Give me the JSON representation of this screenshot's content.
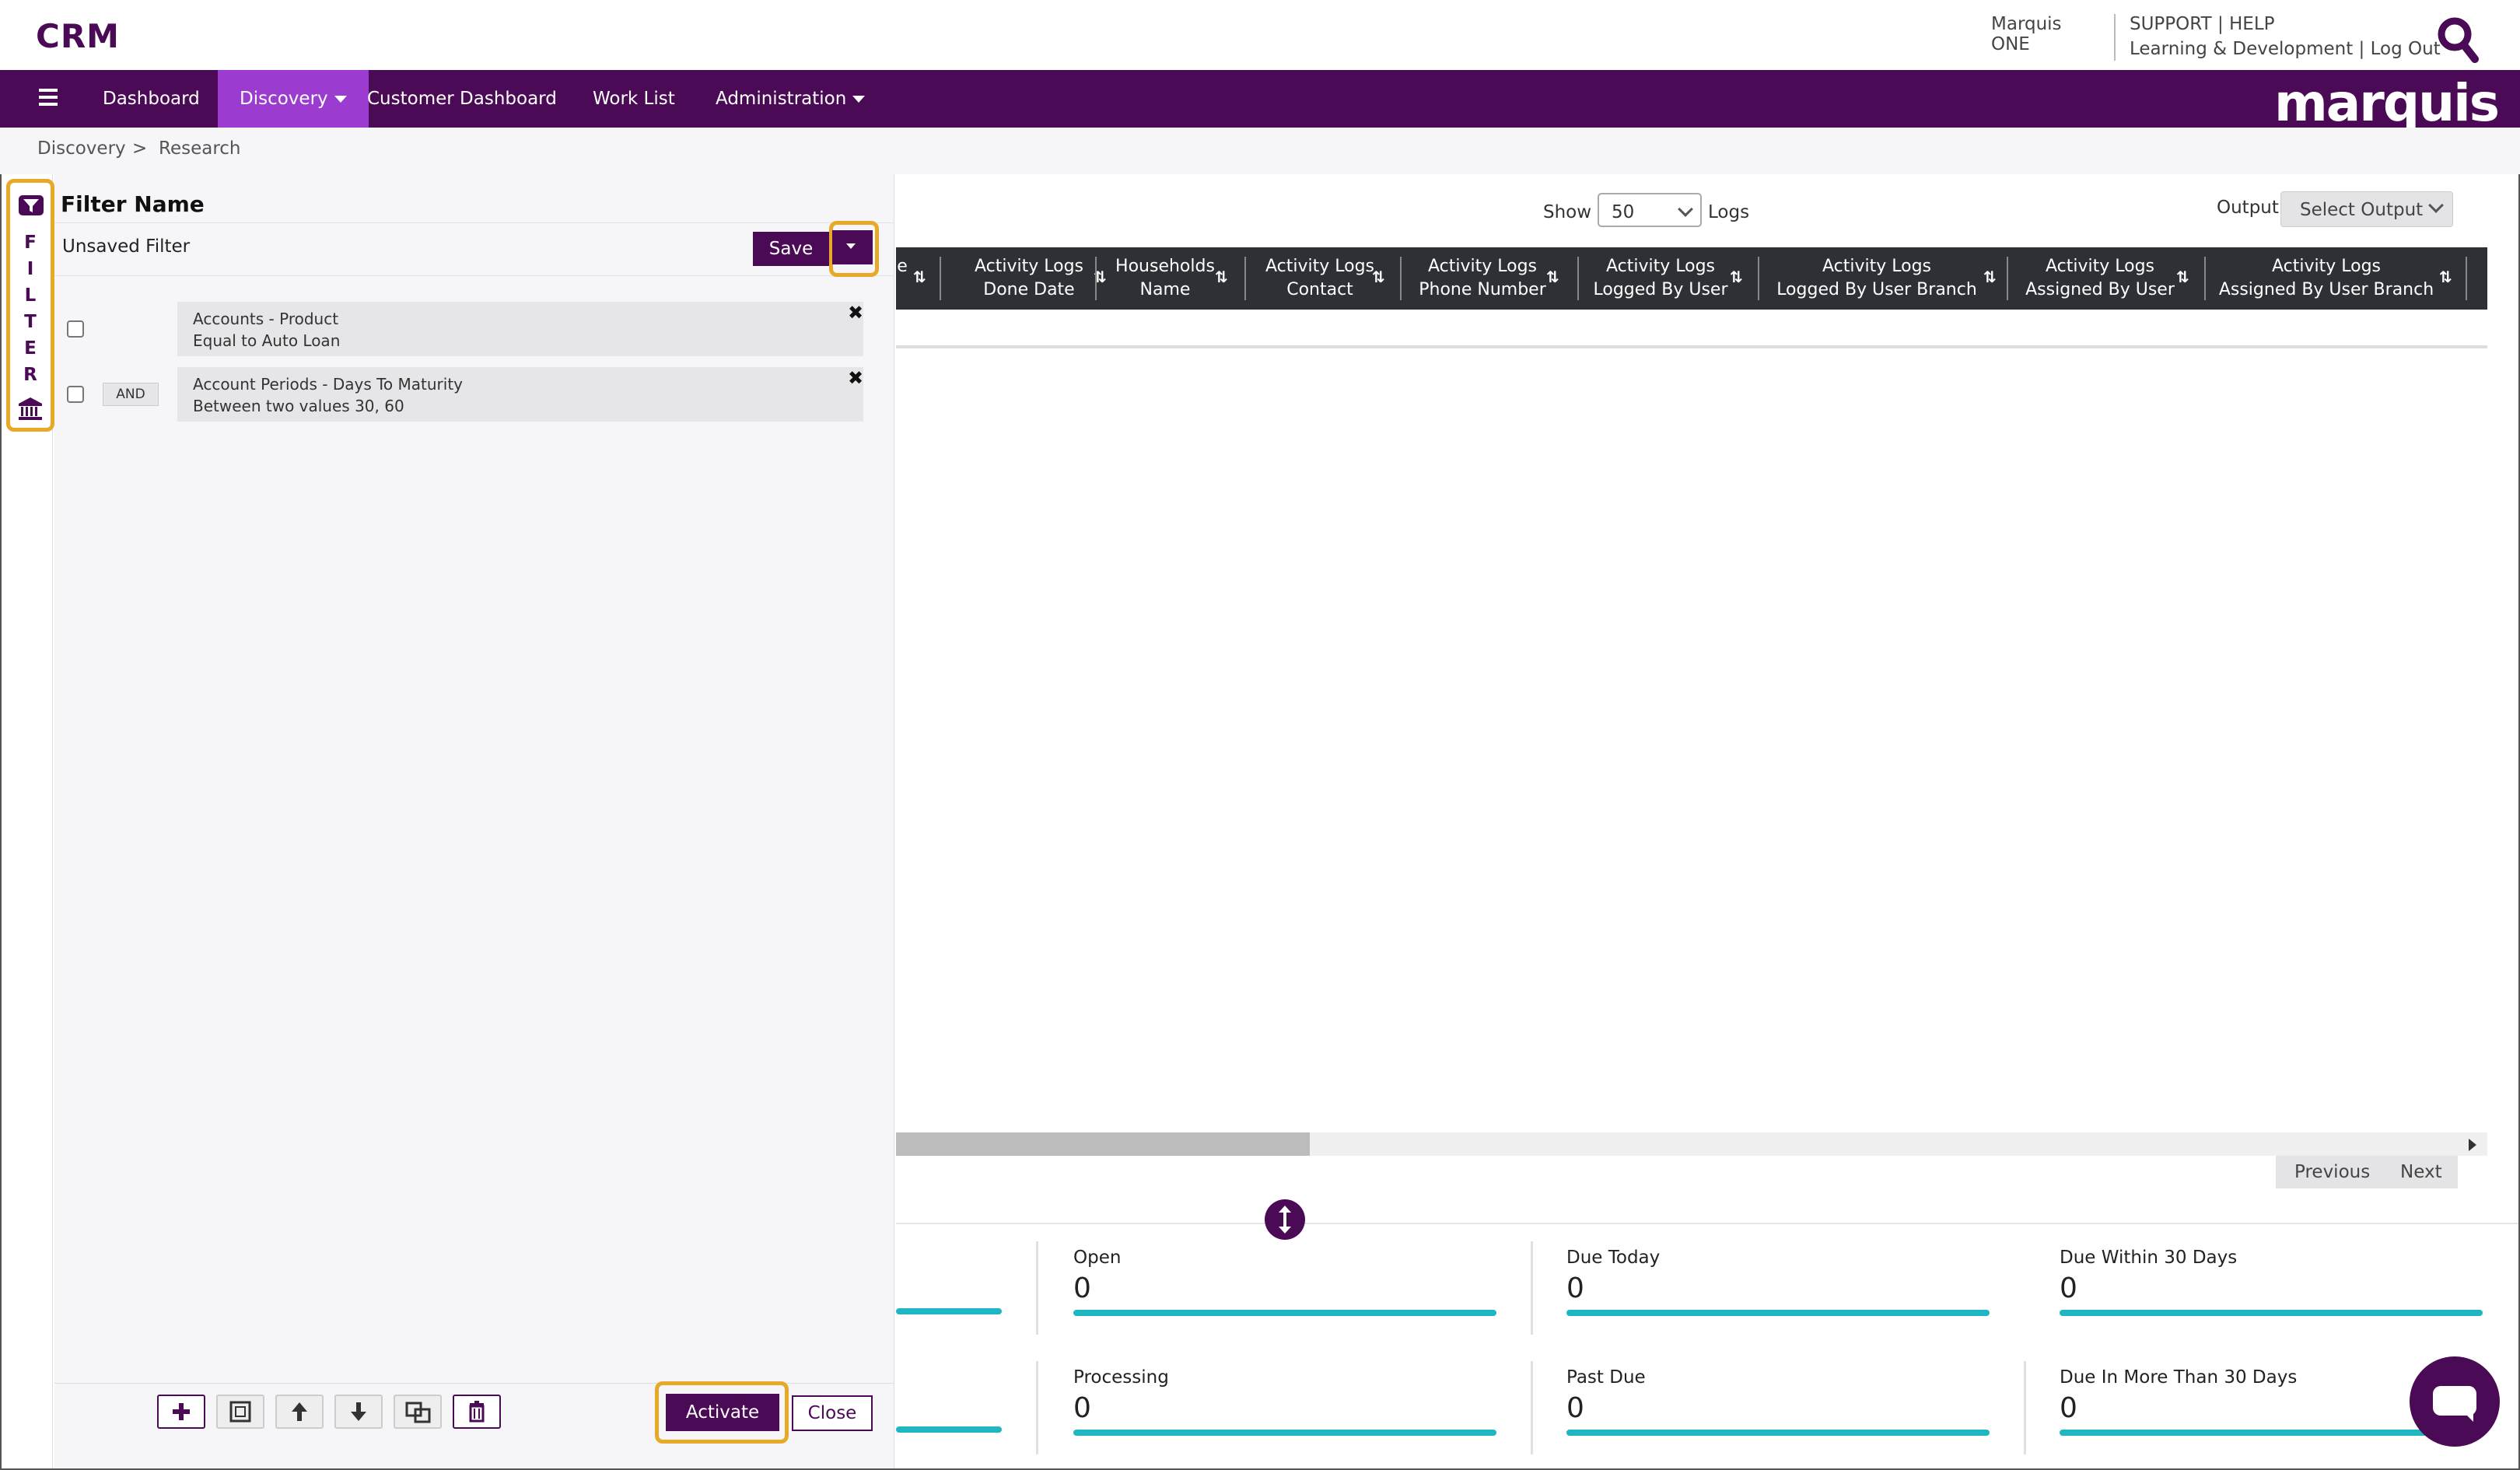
{
  "app": {
    "title": "CRM"
  },
  "top_links": {
    "marquis_one": "Marquis ONE",
    "support": "SUPPORT | HELP",
    "learning": "Learning & Development | Log Out"
  },
  "nav": {
    "brand": "marquis",
    "items": [
      {
        "label": "Dashboard"
      },
      {
        "label": "Discovery",
        "active": true,
        "dropdown": true
      },
      {
        "label": "Customer Dashboard"
      },
      {
        "label": "Work List"
      },
      {
        "label": "Administration",
        "dropdown": true
      }
    ]
  },
  "breadcrumb": {
    "items": [
      "Discovery",
      ">",
      "Research"
    ]
  },
  "filter_panel": {
    "tab_letters": "F\nI\nL\nT\nE\nR",
    "name_label": "Filter Name",
    "filter_value": "Unsaved Filter",
    "save_label": "Save",
    "conditions": [
      {
        "line1": "Accounts - Product",
        "line2": "Equal to Auto Loan",
        "connector": ""
      },
      {
        "line1": "Account Periods - Days To Maturity",
        "line2": "Between two values 30, 60",
        "connector": "AND"
      }
    ],
    "remove_glyph": "✖",
    "activate_label": "Activate",
    "close_label": "Close"
  },
  "results": {
    "show_label": "Show",
    "show_value": "50",
    "logs_label": "Logs",
    "output_label": "Output",
    "output_value": "Select Output",
    "sort_glyph": "⇅",
    "columns": [
      {
        "l1": "e",
        "l2": ""
      },
      {
        "l1": "Activity Logs",
        "l2": "Done Date"
      },
      {
        "l1": "Households",
        "l2": "Name"
      },
      {
        "l1": "Activity Logs",
        "l2": "Contact"
      },
      {
        "l1": "Activity Logs",
        "l2": "Phone Number"
      },
      {
        "l1": "Activity Logs",
        "l2": "Logged By User"
      },
      {
        "l1": "Activity Logs",
        "l2": "Logged By User Branch"
      },
      {
        "l1": "Activity Logs",
        "l2": "Assigned By User"
      },
      {
        "l1": "Activity Logs",
        "l2": "Assigned By User Branch"
      }
    ],
    "pager": {
      "previous": "Previous",
      "next": "Next"
    }
  },
  "stats": [
    {
      "label": "Open",
      "value": "0"
    },
    {
      "label": "Due Today",
      "value": "0"
    },
    {
      "label": "Due Within 30 Days",
      "value": "0"
    },
    {
      "label": "Processing",
      "value": "0"
    },
    {
      "label": "Past Due",
      "value": "0"
    },
    {
      "label": "Due In More Than 30 Days",
      "value": "0"
    }
  ],
  "colors": {
    "brand": "#4b0a55",
    "nav_active": "#9b3bcf",
    "highlight": "#e8a828",
    "stat_bar": "#1eb6c2",
    "table_header": "#2d3035"
  }
}
